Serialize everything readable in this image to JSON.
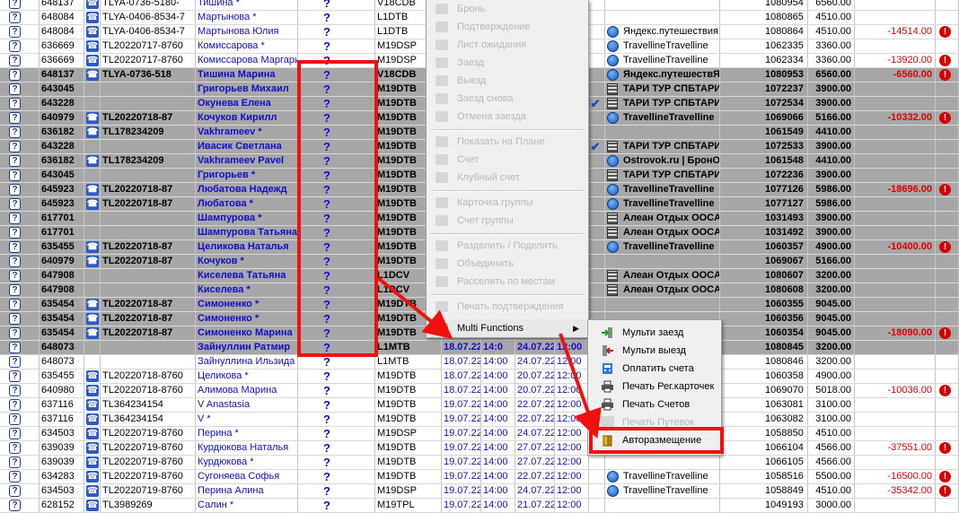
{
  "rows": [
    {
      "id": "648137",
      "code": "TLYA-0736-5180-",
      "name": "Тишина *",
      "room": "V18CDB",
      "acc": "1080954",
      "price": "6560.00",
      "agent": "",
      "diff": "",
      "sel": false,
      "phone": true,
      "agentIcon": "",
      "check": false
    },
    {
      "id": "648084",
      "code": "TLYA-0406-8534-7",
      "name": "Мартынова *",
      "room": "L1DTB",
      "acc": "1080865",
      "price": "4510.00",
      "agent": "",
      "diff": "",
      "sel": false,
      "phone": true,
      "agentIcon": "",
      "check": false
    },
    {
      "id": "648084",
      "code": "TLYA-0406-8534-7",
      "name": "Мартынова Юлия",
      "room": "L1DTB",
      "acc": "1080864",
      "price": "4510.00",
      "agent": "Яндекс.путешествия",
      "diff": "-14514.00",
      "sel": false,
      "phone": true,
      "agentIcon": "globe",
      "check": false
    },
    {
      "id": "636669",
      "code": "TL20220717-8760",
      "name": "Комиссарова *",
      "room": "M19DSP",
      "acc": "1062335",
      "price": "3360.00",
      "agent": "Travelline",
      "diff": "",
      "sel": false,
      "phone": true,
      "agentIcon": "globe",
      "check": false
    },
    {
      "id": "636669",
      "code": "TL20220717-8760",
      "name": "Комиссарова Маргарит",
      "room": "M19DSP",
      "acc": "1062334",
      "price": "3360.00",
      "agent": "Travelline",
      "diff": "-13920.00",
      "sel": false,
      "phone": true,
      "agentIcon": "globe",
      "check": false
    },
    {
      "id": "648137",
      "code": "TLYA-0736-518",
      "name": "Тишина Марина",
      "room": "V18CDB",
      "acc": "1080953",
      "price": "6560.00",
      "agent": "Яндекс.путешеств",
      "diff": "-6560.00",
      "sel": true,
      "phone": true,
      "agentIcon": "globe",
      "check": false
    },
    {
      "id": "643045",
      "code": "",
      "name": "Григорьев Михаил",
      "room": "M19DTB",
      "acc": "1072237",
      "price": "3900.00",
      "agent": "ТАРИ ТУР СПБ",
      "diff": "",
      "sel": true,
      "phone": false,
      "agentIcon": "bld",
      "check": false
    },
    {
      "id": "643228",
      "code": "",
      "name": "Окунева Елена",
      "room": "M19DTB",
      "acc": "1072534",
      "price": "3900.00",
      "agent": "ТАРИ ТУР СПБ",
      "diff": "",
      "sel": true,
      "phone": false,
      "agentIcon": "bld",
      "check": true
    },
    {
      "id": "640979",
      "code": "TL20220718-87",
      "name": "Кочуков Кирилл",
      "room": "M19DTB",
      "acc": "1069066",
      "price": "5166.00",
      "agent": "Travelline",
      "diff": "-10332.00",
      "sel": true,
      "phone": true,
      "agentIcon": "globe",
      "check": false
    },
    {
      "id": "636182",
      "code": "TL178234209",
      "name": "Vakhrameev *",
      "room": "M19DTB",
      "acc": "1061549",
      "price": "4410.00",
      "agent": "",
      "diff": "",
      "sel": true,
      "phone": true,
      "agentIcon": "",
      "check": false
    },
    {
      "id": "643228",
      "code": "",
      "name": "Ивасик Светлана",
      "room": "M19DTB",
      "acc": "1072533",
      "price": "3900.00",
      "agent": "ТАРИ ТУР СПБ",
      "diff": "",
      "sel": true,
      "phone": false,
      "agentIcon": "bld",
      "check": true
    },
    {
      "id": "636182",
      "code": "TL178234209",
      "name": "Vakhrameev Pavel",
      "room": "M19DTB",
      "acc": "1061548",
      "price": "4410.00",
      "agent": "Ostrovok.ru | Брон",
      "diff": "",
      "sel": true,
      "phone": true,
      "agentIcon": "globe",
      "check": false
    },
    {
      "id": "643045",
      "code": "",
      "name": "Григорьев *",
      "room": "M19DTB",
      "acc": "1072236",
      "price": "3900.00",
      "agent": "ТАРИ ТУР СПБ",
      "diff": "",
      "sel": true,
      "phone": false,
      "agentIcon": "bld",
      "check": false
    },
    {
      "id": "645923",
      "code": "TL20220718-87",
      "name": "Любатова Надежд",
      "room": "M19DTB",
      "acc": "1077126",
      "price": "5986.00",
      "agent": "Travelline",
      "diff": "-18696.00",
      "sel": true,
      "phone": true,
      "agentIcon": "globe",
      "check": false
    },
    {
      "id": "645923",
      "code": "TL20220718-87",
      "name": "Любатова *",
      "room": "M19DTB",
      "acc": "1077127",
      "price": "5986.00",
      "agent": "Travelline",
      "diff": "",
      "sel": true,
      "phone": true,
      "agentIcon": "globe",
      "check": false
    },
    {
      "id": "617701",
      "code": "",
      "name": "Шампурова *",
      "room": "M19DTB",
      "acc": "1031493",
      "price": "3900.00",
      "agent": "Алеан Отдых ООС",
      "diff": "",
      "sel": true,
      "phone": false,
      "agentIcon": "bld",
      "check": false
    },
    {
      "id": "617701",
      "code": "",
      "name": "Шампурова Татьяна",
      "room": "M19DTB",
      "acc": "1031492",
      "price": "3900.00",
      "agent": "Алеан Отдых ООС",
      "diff": "",
      "sel": true,
      "phone": false,
      "agentIcon": "bld",
      "check": false
    },
    {
      "id": "635455",
      "code": "TL20220718-87",
      "name": "Целикова Наталья",
      "room": "M19DTB",
      "acc": "1060357",
      "price": "4900.00",
      "agent": "Travelline",
      "diff": "-10400.00",
      "sel": true,
      "phone": true,
      "agentIcon": "globe",
      "check": false
    },
    {
      "id": "640979",
      "code": "TL20220718-87",
      "name": "Кочуков *",
      "room": "M19DTB",
      "acc": "1069067",
      "price": "5166.00",
      "agent": "",
      "diff": "",
      "sel": true,
      "phone": true,
      "agentIcon": "",
      "check": false
    },
    {
      "id": "647908",
      "code": "",
      "name": "Киселева Татьяна",
      "room": "L1DCV",
      "acc": "1080607",
      "price": "3200.00",
      "agent": "Алеан Отдых ООС",
      "diff": "",
      "sel": true,
      "phone": false,
      "agentIcon": "bld",
      "check": false
    },
    {
      "id": "647908",
      "code": "",
      "name": "Киселева *",
      "room": "L1DCV",
      "acc": "1080608",
      "price": "3200.00",
      "agent": "Алеан Отдых ООС",
      "diff": "",
      "sel": true,
      "phone": false,
      "agentIcon": "bld",
      "check": false
    },
    {
      "id": "635454",
      "code": "TL20220718-87",
      "name": "Симоненко *",
      "room": "M19DTB",
      "acc": "1060355",
      "price": "9045.00",
      "agent": "",
      "diff": "",
      "sel": true,
      "phone": true,
      "agentIcon": "",
      "check": false
    },
    {
      "id": "635454",
      "code": "TL20220718-87",
      "name": "Симоненко *",
      "room": "M19DTB",
      "acc": "1060356",
      "price": "9045.00",
      "agent": "",
      "diff": "",
      "sel": true,
      "phone": true,
      "agentIcon": "",
      "check": false
    },
    {
      "id": "635454",
      "code": "TL20220718-87",
      "name": "Симоненко Марина",
      "room": "M19DTB",
      "acc": "1060354",
      "price": "9045.00",
      "agent": "",
      "diff": "-18090.00",
      "sel": true,
      "phone": true,
      "agentIcon": "",
      "check": false
    },
    {
      "id": "648073",
      "code": "",
      "name": "Зайнуллин Ратмир",
      "room": "L1MTB",
      "d1": "18.07.22",
      "t1": "14:0",
      "d2": "24.07.22",
      "t2": "12:00",
      "acc": "1080845",
      "price": "3200.00",
      "agent": "",
      "diff": "",
      "sel": true,
      "phone": false,
      "agentIcon": "",
      "check": false
    },
    {
      "id": "648073",
      "code": "",
      "name": "Зайнуллина Ильзида",
      "room": "L1MTB",
      "d1": "18.07.22",
      "t1": "14:00",
      "d2": "24.07.22",
      "t2": "12:00",
      "acc": "1080846",
      "price": "3200.00",
      "agent": "",
      "diff": "",
      "sel": false,
      "phone": false,
      "agentIcon": "",
      "check": false
    },
    {
      "id": "635455",
      "code": "TL20220718-8760",
      "name": "Целикова *",
      "room": "M19DTB",
      "d1": "18.07.22",
      "t1": "14:00",
      "d2": "20.07.22",
      "t2": "12:00",
      "acc": "1060358",
      "price": "4900.00",
      "agent": "",
      "diff": "",
      "sel": false,
      "phone": true,
      "agentIcon": "",
      "check": false
    },
    {
      "id": "640980",
      "code": "TL20220718-8760",
      "name": "Алимова Марина",
      "room": "M19DTB",
      "d1": "18.07.22",
      "t1": "14:00",
      "d2": "20.07.22",
      "t2": "12:00",
      "acc": "1069070",
      "price": "5018.00",
      "agent": "",
      "diff": "-10036.00",
      "sel": false,
      "phone": true,
      "agentIcon": "",
      "check": false
    },
    {
      "id": "637116",
      "code": "TL364234154",
      "name": "V Anastasia",
      "room": "M19DTB",
      "d1": "19.07.22",
      "t1": "14:00",
      "d2": "22.07.22",
      "t2": "12:00",
      "acc": "1063081",
      "price": "3100.00",
      "agent": "",
      "diff": "",
      "sel": false,
      "phone": true,
      "agentIcon": "",
      "check": false
    },
    {
      "id": "637116",
      "code": "TL364234154",
      "name": "V *",
      "room": "M19DTB",
      "d1": "19.07.22",
      "t1": "14:00",
      "d2": "22.07.22",
      "t2": "12:00",
      "acc": "1063082",
      "price": "3100.00",
      "agent": "",
      "diff": "",
      "sel": false,
      "phone": true,
      "agentIcon": "",
      "check": false
    },
    {
      "id": "634503",
      "code": "TL20220719-8760",
      "name": "Перина *",
      "room": "M19DSP",
      "d1": "19.07.22",
      "t1": "14:00",
      "d2": "24.07.22",
      "t2": "12:00",
      "acc": "1058850",
      "price": "4510.00",
      "agent": "",
      "diff": "",
      "sel": false,
      "phone": true,
      "agentIcon": "",
      "check": false
    },
    {
      "id": "639039",
      "code": "TL20220719-8760",
      "name": "Курдюкова Наталья",
      "room": "M19DTB",
      "d1": "19.07.22",
      "t1": "14:00",
      "d2": "27.07.22",
      "t2": "12:00",
      "acc": "1066104",
      "price": "4566.00",
      "agent": "",
      "diff": "-37551.00",
      "sel": false,
      "phone": true,
      "agentIcon": "",
      "check": false
    },
    {
      "id": "639039",
      "code": "TL20220719-8760",
      "name": "Курдюкова *",
      "room": "M19DTB",
      "d1": "19.07.22",
      "t1": "14:00",
      "d2": "27.07.22",
      "t2": "12:00",
      "acc": "1066105",
      "price": "4566.00",
      "agent": "",
      "diff": "",
      "sel": false,
      "phone": true,
      "agentIcon": "",
      "check": false
    },
    {
      "id": "634283",
      "code": "TL20220719-8760",
      "name": "Сугоняева Софья",
      "room": "M19DTB",
      "d1": "19.07.22",
      "t1": "14:00",
      "d2": "22.07.22",
      "t2": "12:00",
      "acc": "1058516",
      "price": "5500.00",
      "agent": "Travelline",
      "diff": "-16500.00",
      "sel": false,
      "phone": true,
      "agentIcon": "globe",
      "check": false
    },
    {
      "id": "634503",
      "code": "TL20220719-8760",
      "name": "Перина Алина",
      "room": "M19DSP",
      "d1": "19.07.22",
      "t1": "14:00",
      "d2": "24.07.22",
      "t2": "12:00",
      "acc": "1058849",
      "price": "4510.00",
      "agent": "Travelline",
      "diff": "-35342.00",
      "sel": false,
      "phone": true,
      "agentIcon": "globe",
      "check": false
    },
    {
      "id": "628152",
      "code": "TL3989269",
      "name": "Салин *",
      "room": "M19TPL",
      "d1": "19.07.22",
      "t1": "14:00",
      "d2": "21.07.22",
      "t2": "12:00",
      "acc": "1049193",
      "price": "3000.00",
      "agent": "",
      "diff": "",
      "sel": false,
      "phone": true,
      "agentIcon": "",
      "check": false
    }
  ],
  "menu": {
    "items": [
      {
        "label": "Бронь"
      },
      {
        "label": "Подтверждение"
      },
      {
        "label": "Лист ожидания"
      },
      {
        "label": "Заезд"
      },
      {
        "label": "Выезд"
      },
      {
        "label": "Заезд снова"
      },
      {
        "label": "Отмена заезда"
      },
      {
        "label": "Показать на Плане"
      },
      {
        "label": "Счет"
      },
      {
        "label": "Клубный счет"
      },
      {
        "label": "Карточка группы"
      },
      {
        "label": "Счет группы"
      },
      {
        "label": "Разделить / Поделить"
      },
      {
        "label": "Объединить"
      },
      {
        "label": "Расселить по местам"
      },
      {
        "label": "Печать подтверждения"
      },
      {
        "label": "Multi Functions"
      }
    ]
  },
  "submenu": {
    "items": [
      {
        "label": "Мульти заезд"
      },
      {
        "label": "Мульти выезд"
      },
      {
        "label": "Оплатить счета"
      },
      {
        "label": "Печать Рег.карточек"
      },
      {
        "label": "Печать Счетов"
      },
      {
        "label": "Печать Путевок"
      },
      {
        "label": "Авторазмещение"
      }
    ]
  },
  "colors": {
    "annotation": "#f01010",
    "selected_row": "#a7a7a7",
    "link_blue": "#1010c8",
    "negative_red": "#e00000"
  }
}
